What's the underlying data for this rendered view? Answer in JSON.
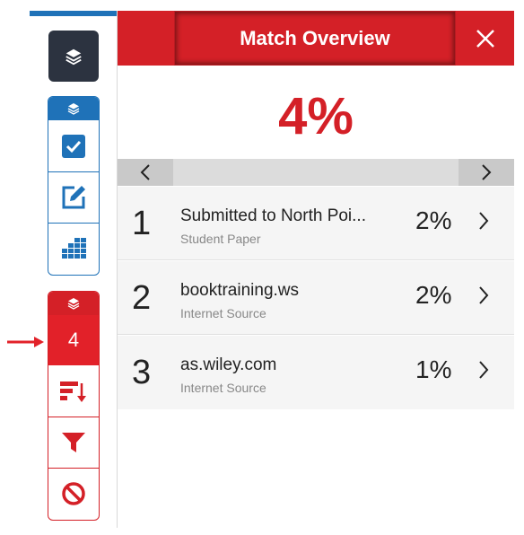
{
  "panel": {
    "title": "Match Overview",
    "overall_similarity": "4%"
  },
  "sidebar": {
    "match_count": "4",
    "icons": {
      "layers_top": "layers-icon",
      "blue_header": "layers-icon",
      "check": "checkbox-icon",
      "edit": "edit-icon",
      "grid": "grid-icon",
      "red_header": "layers-icon",
      "sort": "sort-icon",
      "filter": "filter-icon",
      "exclude": "block-icon"
    }
  },
  "matches": [
    {
      "rank": "1",
      "source": "Submitted to North Poi...",
      "type": "Student Paper",
      "percent": "2%"
    },
    {
      "rank": "2",
      "source": "booktraining.ws",
      "type": "Internet Source",
      "percent": "2%"
    },
    {
      "rank": "3",
      "source": "as.wiley.com",
      "type": "Internet Source",
      "percent": "1%"
    }
  ],
  "colors": {
    "accent_red": "#d42027",
    "accent_blue": "#1f72b8",
    "dark": "#2c3340"
  }
}
